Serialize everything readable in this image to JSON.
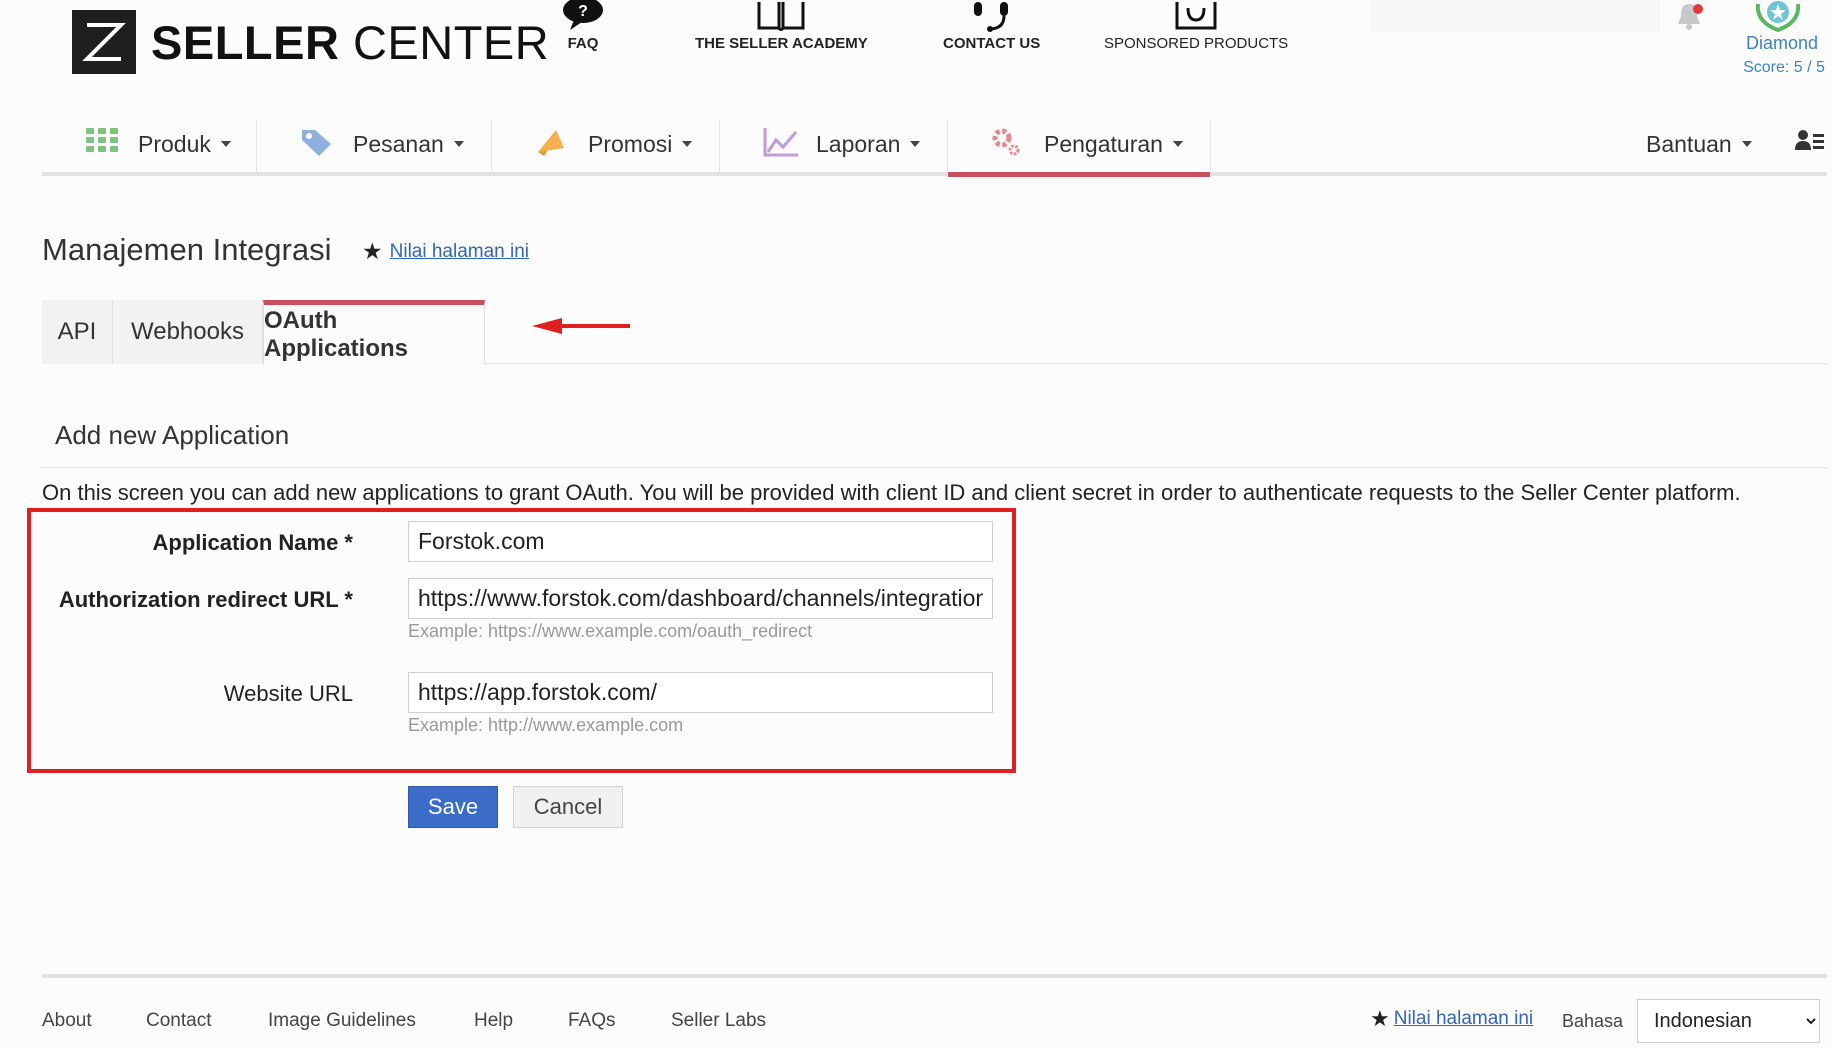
{
  "brand": {
    "logo_letter": "Z",
    "name_bold": "SELLER",
    "name_light": " CENTER"
  },
  "topnav": [
    {
      "label": "FAQ",
      "icon": "faq-icon"
    },
    {
      "label": "THE SELLER ACADEMY",
      "icon": "book-icon"
    },
    {
      "label": "CONTACT US",
      "icon": "headset-icon"
    },
    {
      "label": "SPONSORED PRODUCTS",
      "icon": "bag-icon"
    }
  ],
  "account": {
    "tier": "Diamond",
    "score": "Score: 5 / 5"
  },
  "mainnav": [
    {
      "label": "Produk",
      "icon": "grid-icon"
    },
    {
      "label": "Pesanan",
      "icon": "tag-icon"
    },
    {
      "label": "Promosi",
      "icon": "megaphone-icon"
    },
    {
      "label": "Laporan",
      "icon": "chart-icon"
    },
    {
      "label": "Pengaturan",
      "icon": "gear-icon",
      "active": true
    }
  ],
  "help_menu": "Bantuan",
  "page": {
    "title": "Manajemen Integrasi",
    "rate_link": "Nilai halaman ini"
  },
  "tabs": [
    {
      "label": "API"
    },
    {
      "label": "Webhooks"
    },
    {
      "label": "OAuth Applications",
      "active": true
    }
  ],
  "form": {
    "section_title": "Add new Application",
    "intro": "On this screen you can add new applications to grant OAuth. You will be provided with client ID and client secret in order to authenticate requests to the Seller Center platform.",
    "app_name": {
      "label": "Application Name *",
      "value": "Forstok.com"
    },
    "redirect_url": {
      "label": "Authorization redirect URL *",
      "value": "https://www.forstok.com/dashboard/channels/integration",
      "help": "Example: https://www.example.com/oauth_redirect"
    },
    "website_url": {
      "label": "Website URL",
      "value": "https://app.forstok.com/",
      "help": "Example: http://www.example.com"
    },
    "save_label": "Save",
    "cancel_label": "Cancel"
  },
  "footer": {
    "links": [
      "About",
      "Contact",
      "Image Guidelines",
      "Help",
      "FAQs",
      "Seller Labs"
    ],
    "rate_link": "Nilai halaman ini",
    "language_label": "Bahasa",
    "language_value": "Indonesian"
  },
  "colors": {
    "accent": "#c8505a",
    "primary_button": "#3b6cc7",
    "highlight_box": "#e02020",
    "link": "#3366bb",
    "badge": "#3d83c3"
  }
}
